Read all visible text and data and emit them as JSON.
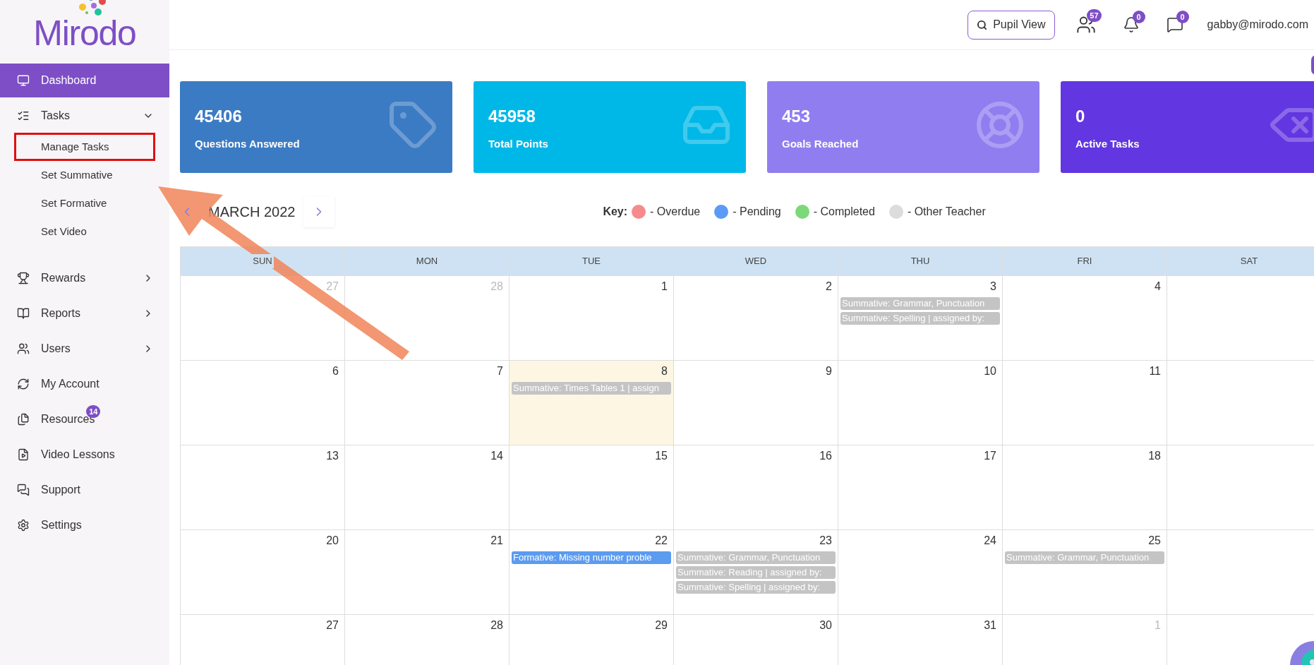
{
  "logo": {
    "text": "Mirodo"
  },
  "sidebar": {
    "items": [
      {
        "label": "Dashboard",
        "selected": true
      },
      {
        "label": "Tasks",
        "selected": false,
        "expanded": true,
        "children": [
          {
            "label": "Manage Tasks",
            "highlighted": true
          },
          {
            "label": "Set Summative",
            "highlighted": false
          },
          {
            "label": "Set Formative",
            "highlighted": false
          },
          {
            "label": "Set Video",
            "highlighted": false
          }
        ]
      },
      {
        "label": "Rewards",
        "selected": false,
        "expanded": false
      },
      {
        "label": "Reports",
        "selected": false,
        "expanded": false
      },
      {
        "label": "Users",
        "selected": false,
        "expanded": false
      },
      {
        "label": "My Account",
        "selected": false
      },
      {
        "label": "Resources",
        "selected": false,
        "badge": "14"
      },
      {
        "label": "Video Lessons",
        "selected": false
      },
      {
        "label": "Support",
        "selected": false
      },
      {
        "label": "Settings",
        "selected": false
      }
    ]
  },
  "topbar": {
    "pupil_view": "Pupil View",
    "pupils_badge": "57",
    "notifications_badge": "0",
    "messages_badge": "0",
    "user": "gabby@mirodo.com"
  },
  "stats": [
    {
      "value": "45406",
      "label": "Questions Answered",
      "color": "#3b7bc4"
    },
    {
      "value": "45958",
      "label": "Total Points",
      "color": "#00b8e8"
    },
    {
      "value": "453",
      "label": "Goals Reached",
      "color": "#907ef0"
    },
    {
      "value": "0",
      "label": "Active Tasks",
      "color": "#6236e0"
    }
  ],
  "calendar": {
    "month": "MARCH 2022",
    "key_label": "Key:",
    "key": [
      {
        "label": "- Overdue",
        "color": "#f78b8b"
      },
      {
        "label": "- Pending",
        "color": "#5b9bf5"
      },
      {
        "label": "- Completed",
        "color": "#7dd87a"
      },
      {
        "label": "- Other Teacher",
        "color": "#dcdcdc"
      }
    ],
    "weekdays": [
      "SUN",
      "MON",
      "TUE",
      "WED",
      "THU",
      "FRI",
      "SAT"
    ],
    "weeks": [
      [
        {
          "day": "27",
          "muted": true,
          "today": false
        },
        {
          "day": "28",
          "muted": true,
          "today": false
        },
        {
          "day": "1",
          "muted": false,
          "today": false
        },
        {
          "day": "2",
          "muted": false,
          "today": false
        },
        {
          "day": "3",
          "muted": false,
          "today": false,
          "events": [
            {
              "text": "Summative: Grammar, Punctuation",
              "color": "#c4c4c4"
            },
            {
              "text": "Summative: Spelling | assigned by:",
              "color": "#c4c4c4"
            }
          ]
        },
        {
          "day": "4",
          "muted": false,
          "today": false
        }
      ],
      [
        {
          "day": "6",
          "muted": false,
          "today": false
        },
        {
          "day": "7",
          "muted": false,
          "today": false
        },
        {
          "day": "8",
          "muted": false,
          "today": true,
          "events": [
            {
              "text": "Summative: Times Tables 1 | assign",
              "color": "#c4c4c4"
            }
          ]
        },
        {
          "day": "9",
          "muted": false,
          "today": false
        },
        {
          "day": "10",
          "muted": false,
          "today": false
        },
        {
          "day": "11",
          "muted": false,
          "today": false
        }
      ],
      [
        {
          "day": "13",
          "muted": false,
          "today": false
        },
        {
          "day": "14",
          "muted": false,
          "today": false
        },
        {
          "day": "15",
          "muted": false,
          "today": false
        },
        {
          "day": "16",
          "muted": false,
          "today": false
        },
        {
          "day": "17",
          "muted": false,
          "today": false
        },
        {
          "day": "18",
          "muted": false,
          "today": false
        }
      ],
      [
        {
          "day": "20",
          "muted": false,
          "today": false
        },
        {
          "day": "21",
          "muted": false,
          "today": false
        },
        {
          "day": "22",
          "muted": false,
          "today": false,
          "events": [
            {
              "text": "Formative: Missing number proble",
              "color": "#5b9bf0"
            }
          ]
        },
        {
          "day": "23",
          "muted": false,
          "today": false,
          "events": [
            {
              "text": "Summative: Grammar, Punctuation",
              "color": "#c4c4c4"
            },
            {
              "text": "Summative: Reading | assigned by:",
              "color": "#c4c4c4"
            },
            {
              "text": "Summative: Spelling | assigned by:",
              "color": "#c4c4c4"
            }
          ]
        },
        {
          "day": "24",
          "muted": false,
          "today": false
        },
        {
          "day": "25",
          "muted": false,
          "today": false,
          "events": [
            {
              "text": "Summative: Grammar, Punctuation",
              "color": "#c4c4c4"
            }
          ]
        }
      ],
      [
        {
          "day": "27",
          "muted": false,
          "today": false
        },
        {
          "day": "28",
          "muted": false,
          "today": false
        },
        {
          "day": "29",
          "muted": false,
          "today": false
        },
        {
          "day": "30",
          "muted": false,
          "today": false
        },
        {
          "day": "31",
          "muted": false,
          "today": false
        },
        {
          "day": "1",
          "muted": true,
          "today": false
        }
      ]
    ]
  }
}
